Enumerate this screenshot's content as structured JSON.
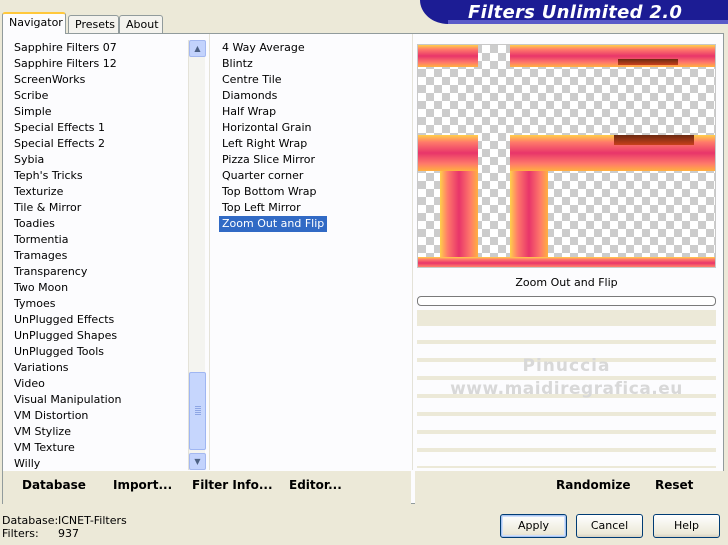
{
  "app_title": "Filters Unlimited 2.0",
  "tabs": [
    {
      "label": "Navigator",
      "active": true
    },
    {
      "label": "Presets",
      "active": false
    },
    {
      "label": "About",
      "active": false
    }
  ],
  "categories": [
    "Sapphire Filters 07",
    "Sapphire Filters 12",
    "ScreenWorks",
    "Scribe",
    "Simple",
    "Special Effects 1",
    "Special Effects 2",
    "Sybia",
    "Teph's Tricks",
    "Texturize",
    "Tile & Mirror",
    "Toadies",
    "Tormentia",
    "Tramages",
    "Transparency",
    "Two Moon",
    "Tymoes",
    "UnPlugged Effects",
    "UnPlugged Shapes",
    "UnPlugged Tools",
    "Variations",
    "Video",
    "Visual Manipulation",
    "VM Distortion",
    "VM Stylize",
    "VM Texture",
    "Willy"
  ],
  "selected_category": "Simple",
  "filters": [
    "4 Way Average",
    "Blintz",
    "Centre Tile",
    "Diamonds",
    "Half Wrap",
    "Horizontal Grain",
    "Left Right Wrap",
    "Pizza Slice Mirror",
    "Quarter corner",
    "Top Bottom Wrap",
    "Top Left Mirror",
    "Zoom Out and Flip"
  ],
  "selected_filter": "Zoom Out and Flip",
  "preview_label": "Zoom Out and Flip",
  "watermark": {
    "line1": "Pinuccia",
    "line2": "www.maidiregrafica.eu"
  },
  "bottom_left_buttons": {
    "database": "Database",
    "import": "Import...",
    "filter_info": "Filter Info...",
    "editor": "Editor..."
  },
  "bottom_right_buttons": {
    "randomize": "Randomize",
    "reset": "Reset"
  },
  "footer": {
    "database_label": "Database:",
    "database_value": "ICNET-Filters",
    "filters_label": "Filters:",
    "filters_value": "937"
  },
  "dialog_buttons": {
    "apply": "Apply",
    "cancel": "Cancel",
    "help": "Help"
  },
  "colors": {
    "title_bar": "#1c1c94",
    "selection": "#316ac5",
    "accent_tab": "#ffc83c"
  },
  "icons": {
    "scroll_up": "chevron-up-icon",
    "scroll_down": "chevron-down-icon"
  }
}
